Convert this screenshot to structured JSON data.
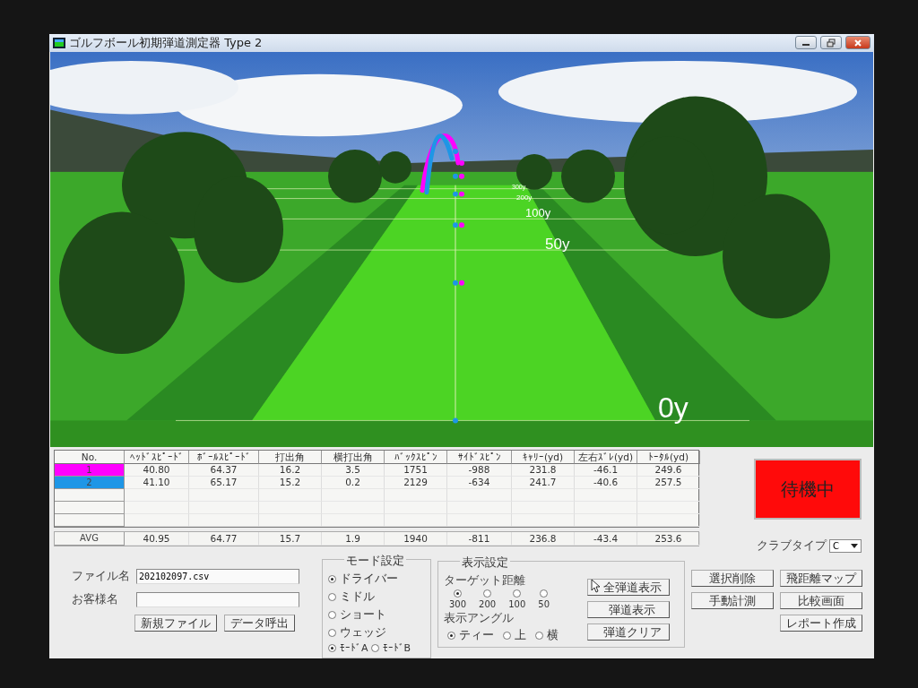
{
  "window": {
    "title": "ゴルフボール初期弾道測定器 Type 2"
  },
  "scene": {
    "distance_labels": [
      "300y",
      "200y",
      "100y",
      "50y",
      "0y"
    ]
  },
  "table": {
    "columns": [
      "No.",
      "ﾍｯﾄﾞｽﾋﾟｰﾄﾞ",
      "ﾎﾞｰﾙｽﾋﾟｰﾄﾞ",
      "打出角",
      "横打出角",
      "ﾊﾞｯｸｽﾋﾟﾝ",
      "ｻｲﾄﾞｽﾋﾟﾝ",
      "ｷｬﾘｰ(yd)",
      "左右ｽﾞﾚ(yd)",
      "ﾄｰﾀﾙ(yd)"
    ],
    "rows": [
      {
        "color": "#ff00ff",
        "cells": [
          "1",
          "40.80",
          "64.37",
          "16.2",
          "3.5",
          "1751",
          "-988",
          "231.8",
          "-46.1",
          "249.6"
        ]
      },
      {
        "color": "#1e96e6",
        "cells": [
          "2",
          "41.10",
          "65.17",
          "15.2",
          "0.2",
          "2129",
          "-634",
          "241.7",
          "-40.6",
          "257.5"
        ]
      }
    ],
    "average": {
      "cells": [
        "AVG",
        "40.95",
        "64.77",
        "15.7",
        "1.9",
        "1940",
        "-811",
        "236.8",
        "-43.4",
        "253.6"
      ]
    }
  },
  "status": {
    "label": "待機中"
  },
  "club_type": {
    "label": "クラブタイプ",
    "value": "C"
  },
  "file": {
    "file_name_label": "ファイル名",
    "file_name": "202102097.csv",
    "customer_label": "お客様名",
    "buttons": [
      "新規ファイル",
      "データ呼出"
    ]
  },
  "mode": {
    "title": "モード設定",
    "options": [
      {
        "label": "ドライバー",
        "selected": true
      },
      {
        "label": "ミドル",
        "selected": false
      },
      {
        "label": "ショート",
        "selected": false
      },
      {
        "label": "ウェッジ",
        "selected": false
      }
    ],
    "variants": [
      {
        "label": "ﾓｰﾄﾞA",
        "selected": true
      },
      {
        "label": "ﾓｰﾄﾞB",
        "selected": false
      }
    ]
  },
  "display": {
    "title": "表示設定",
    "target_label": "ターゲット距離",
    "targets": [
      {
        "label": "300",
        "selected": true
      },
      {
        "label": "200",
        "selected": false
      },
      {
        "label": "100",
        "selected": false
      },
      {
        "label": "50",
        "selected": false
      }
    ],
    "angle_label": "表示アングル",
    "angles": [
      {
        "label": "ティー",
        "selected": true
      },
      {
        "label": "上",
        "selected": false
      },
      {
        "label": "横",
        "selected": false
      }
    ],
    "buttons": [
      "全弾道表示",
      "弾道表示",
      "弾道クリア"
    ]
  },
  "action_columns": [
    [
      "選択削除",
      "手動計測"
    ],
    [
      "飛距離マップ",
      "比較画面",
      "レポート作成"
    ]
  ]
}
